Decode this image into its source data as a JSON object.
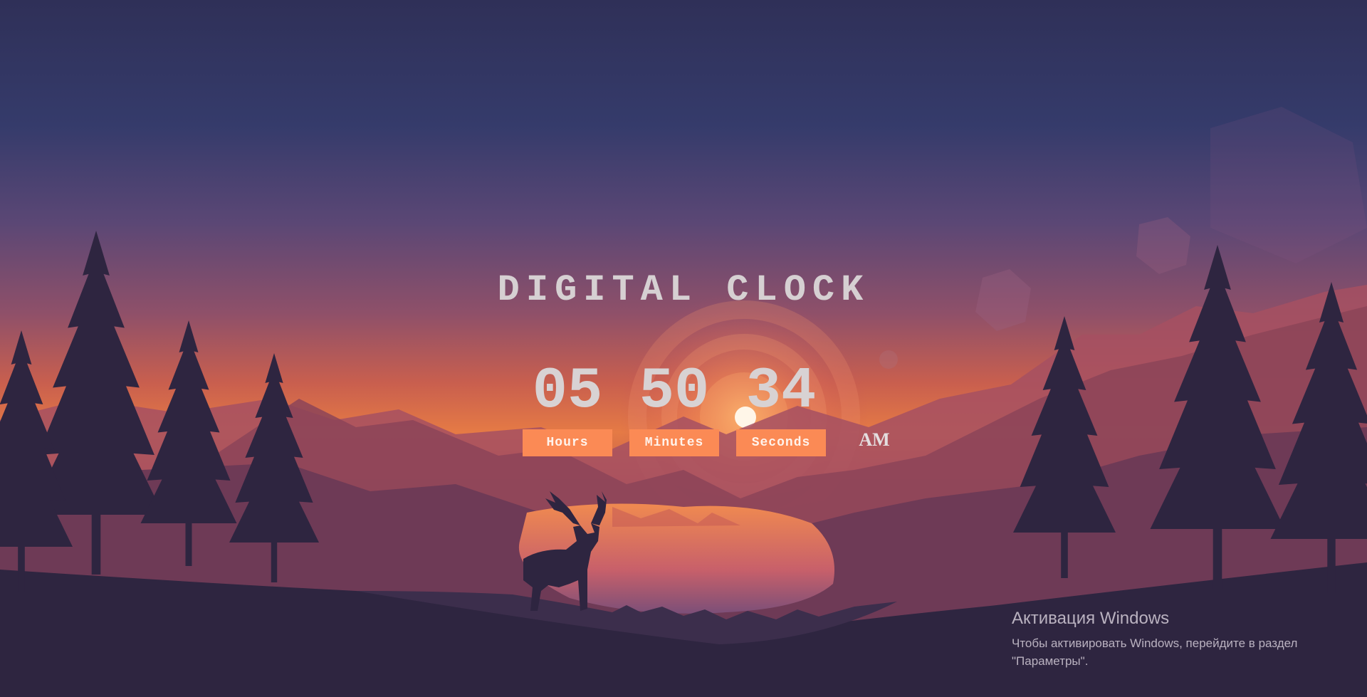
{
  "clock": {
    "title": "DIGITAL CLOCK",
    "hours": "05",
    "minutes": "50",
    "seconds": "34",
    "hours_label": "Hours",
    "minutes_label": "Minutes",
    "seconds_label": "Seconds",
    "period": "AM"
  },
  "activation": {
    "heading": "Активация Windows",
    "line1": "Чтобы активировать Windows, перейдите в раздел",
    "line2": "\"Параметры\"."
  },
  "colors": {
    "label_bg": "#fb8a55",
    "sky_top": "#2f3058",
    "horizon": "#e57a45",
    "silhouette": "#2e2540"
  }
}
